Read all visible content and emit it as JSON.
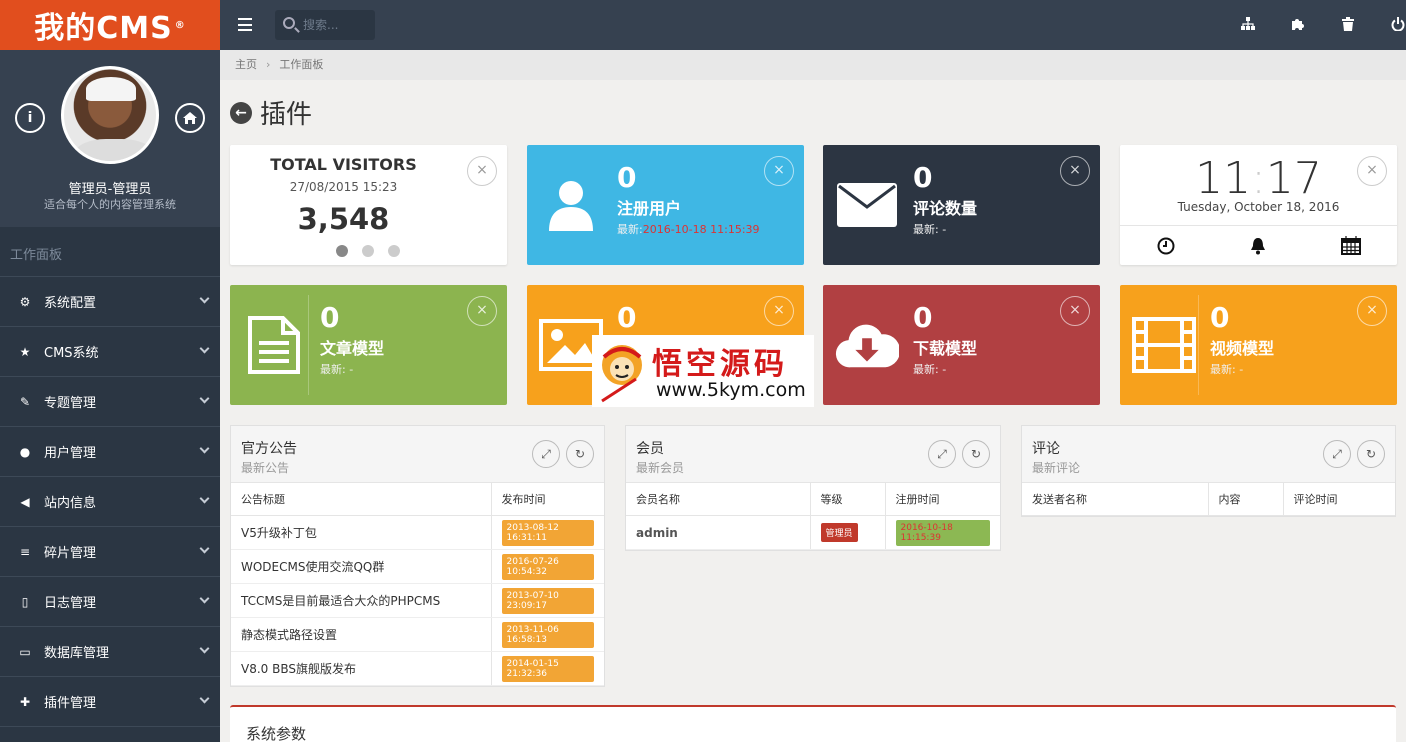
{
  "sidebar": {
    "logo": "我的CMS",
    "logo_mark": "®",
    "user_name": "管理员-管理员",
    "user_subtitle": "适合每个人的内容管理系统",
    "section_heading": "工作面板",
    "items": [
      {
        "label": "系统配置",
        "icon": "gears-icon"
      },
      {
        "label": "CMS系统",
        "icon": "star-icon"
      },
      {
        "label": "专题管理",
        "icon": "pencil-icon"
      },
      {
        "label": "用户管理",
        "icon": "users-icon"
      },
      {
        "label": "站内信息",
        "icon": "bullhorn-icon"
      },
      {
        "label": "碎片管理",
        "icon": "list-icon"
      },
      {
        "label": "日志管理",
        "icon": "book-icon"
      },
      {
        "label": "数据库管理",
        "icon": "hdd-icon"
      },
      {
        "label": "插件管理",
        "icon": "puzzle-icon"
      }
    ]
  },
  "header": {
    "search_placeholder": "搜索...",
    "icons": [
      "sitemap-icon",
      "puzzle-icon",
      "trash-icon",
      "power-icon"
    ]
  },
  "breadcrumb": {
    "home": "主页",
    "current": "工作面板"
  },
  "page": {
    "title": "插件"
  },
  "visitors": {
    "title": "TOTAL VISITORS",
    "date": "27/08/2015 15:23",
    "count": "3,548"
  },
  "tiles": [
    {
      "count": "0",
      "label": "注册用户",
      "latest_prefix": "最新:",
      "latest": "2016-10-18 11:15:39",
      "color": "#3fb7e4"
    },
    {
      "count": "0",
      "label": "评论数量",
      "latest_prefix": "最新:",
      "latest": "-",
      "color": "#2c3542"
    },
    {
      "count": "0",
      "label": "文章模型",
      "latest_prefix": "最新:",
      "latest": "-",
      "color": "#8cb44f"
    },
    {
      "count": "0",
      "label": "",
      "latest_prefix": "",
      "latest": "",
      "color": "#f7a11c"
    },
    {
      "count": "0",
      "label": "下载模型",
      "latest_prefix": "最新:",
      "latest": "-",
      "color": "#b14042"
    },
    {
      "count": "0",
      "label": "视频模型",
      "latest_prefix": "最新:",
      "latest": "-",
      "color": "#f7a11c"
    }
  ],
  "clock": {
    "time_h": "11",
    "time_m": "17",
    "date": "Tuesday, October 18, 2016"
  },
  "panels": {
    "notice": {
      "title": "官方公告",
      "subtitle": "最新公告",
      "columns": [
        "公告标题",
        "发布时间"
      ],
      "rows": [
        [
          "V5升级补丁包",
          "2013-08-12 16:31:11"
        ],
        [
          "WODECMS使用交流QQ群",
          "2016-07-26 10:54:32"
        ],
        [
          "TCCMS是目前最适合大众的PHPCMS",
          "2013-07-10 23:09:17"
        ],
        [
          "静态模式路径设置",
          "2013-11-06 16:58:13"
        ],
        [
          "V8.0 BBS旗舰版发布",
          "2014-01-15 21:32:36"
        ]
      ]
    },
    "members": {
      "title": "会员",
      "subtitle": "最新会员",
      "columns": [
        "会员名称",
        "等级",
        "注册时间"
      ],
      "rows": [
        [
          "admin",
          "管理员",
          "2016-10-18 11:15:39"
        ]
      ]
    },
    "comments": {
      "title": "评论",
      "subtitle": "最新评论",
      "columns": [
        "发送者名称",
        "内容",
        "评论时间"
      ]
    }
  },
  "watermark": {
    "title": "悟空源码",
    "url": "www.5kym.com"
  },
  "sys_params": {
    "title": "系统参数"
  }
}
